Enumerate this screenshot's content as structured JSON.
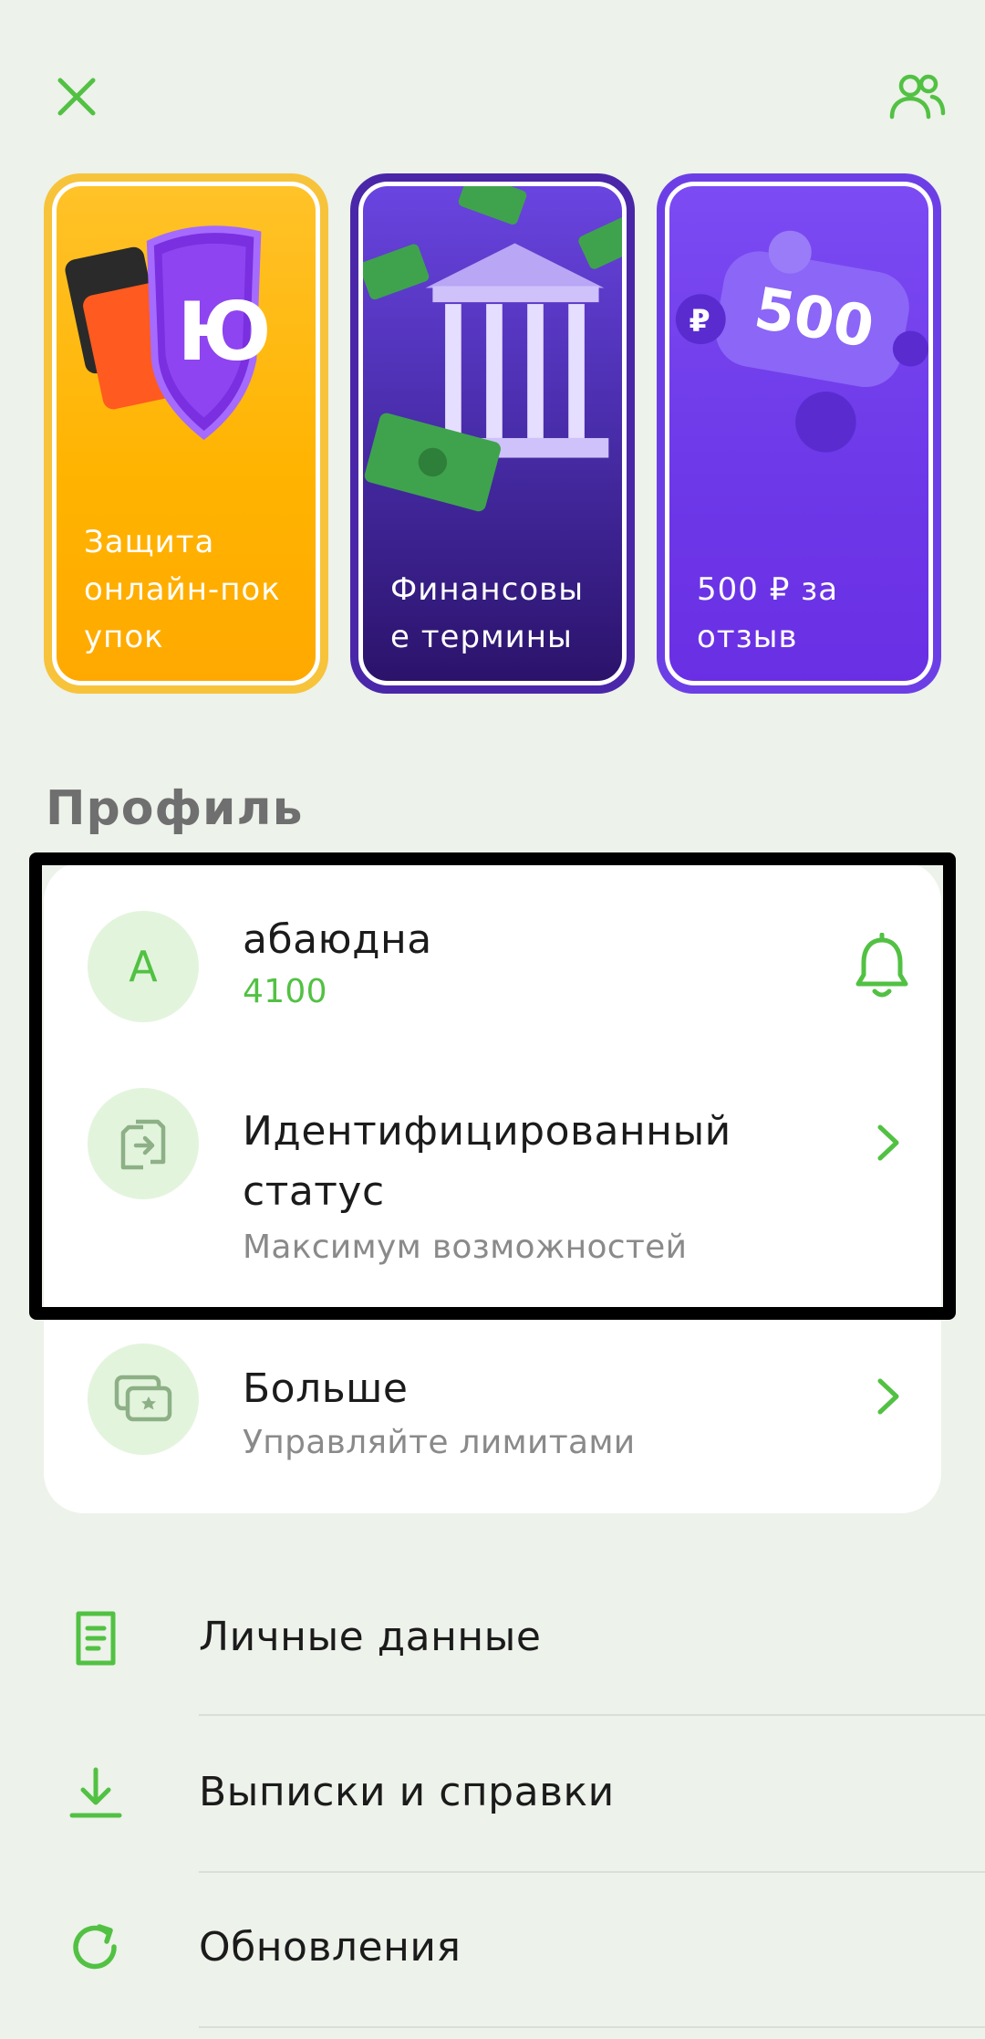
{
  "header": {
    "close_icon": "close-icon",
    "people_icon": "people-icon"
  },
  "stories": [
    {
      "caption": "Защита онлайн-покупок",
      "caption_lines": [
        "Защита",
        "онлайн-пок",
        "упок"
      ],
      "theme": "#FFB300",
      "art_text": "Ю"
    },
    {
      "caption": "Финансовые термины",
      "caption_lines": [
        "Финансовы",
        "е термины"
      ],
      "theme": "#4B2FAF"
    },
    {
      "caption": "500 ₽ за отзыв",
      "caption_lines": [
        "500 ₽ за",
        "отзыв"
      ],
      "theme": "#6D38E8",
      "art_text": "500"
    }
  ],
  "profile": {
    "section_title": "Профиль",
    "user": {
      "avatar_letter": "А",
      "name": "абаюдна",
      "number": "4100",
      "bell_icon": "bell-icon"
    },
    "status": {
      "title_line1": "Идентифицированный",
      "title_line2": "статус",
      "subtitle": "Максимум возможностей",
      "icon": "identity-icon"
    },
    "more": {
      "title": "Больше",
      "subtitle": "Управляйте лимитами",
      "icon": "cards-star-icon"
    }
  },
  "menu": [
    {
      "label": "Личные данные",
      "icon": "document-icon"
    },
    {
      "label": "Выписки и справки",
      "icon": "download-icon"
    },
    {
      "label": "Обновления",
      "icon": "refresh-icon"
    }
  ],
  "colors": {
    "accent": "#52C143",
    "background": "#EDF2EA",
    "avatar_bg": "#E3F4DD",
    "highlight": "#000000"
  }
}
